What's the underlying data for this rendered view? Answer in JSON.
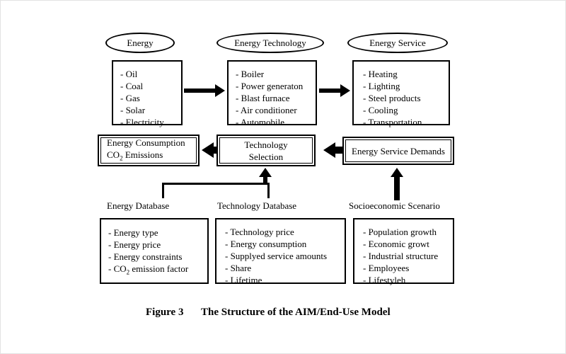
{
  "figure": {
    "caption_number": "Figure 3",
    "caption_title": "The Structure of the AIM/End-Use Model"
  },
  "top_row": {
    "energy": {
      "ellipse_label": "Energy",
      "items": [
        "- Oil",
        "- Coal",
        "- Gas",
        "- Solar",
        "- Electricity"
      ]
    },
    "energy_technology": {
      "ellipse_label": "Energy Technology",
      "items": [
        "- Boiler",
        "- Power generaton",
        "- Blast furnace",
        "- Air conditioner",
        "- Automobile"
      ]
    },
    "energy_service": {
      "ellipse_label": "Energy Service",
      "items": [
        "- Heating",
        "- Lighting",
        "- Steel products",
        "- Cooling",
        "- Transportation"
      ]
    }
  },
  "middle_row": {
    "energy_consumption": {
      "line1": "Energy Consumption",
      "line2_pre": "CO",
      "line2_sub": "2",
      "line2_post": " Emissions"
    },
    "technology_selection": {
      "line1": "Technology",
      "line2": "Selection"
    },
    "energy_service_demands": {
      "line1": "Energy Service Demands"
    }
  },
  "bottom_row": {
    "energy_database": {
      "label": "Energy Database",
      "items": [
        "- Energy type",
        "- Energy price",
        "- Energy constraints"
      ],
      "last_item_pre": "- CO",
      "last_item_sub": "2",
      "last_item_post": " emission factor"
    },
    "technology_database": {
      "label": "Technology Database",
      "items": [
        "- Technology price",
        "- Energy consumption",
        "- Supplyed service amounts",
        "- Share",
        "- Lifetime"
      ]
    },
    "socioeconomic_scenario": {
      "label": "Socioeconomic Scenario",
      "items": [
        "- Population growth",
        "- Economic growt",
        "- Industrial structure",
        "- Employees",
        "- Lifestyleh"
      ]
    }
  },
  "colors": {
    "stroke": "#000000",
    "background": "#ffffff"
  }
}
